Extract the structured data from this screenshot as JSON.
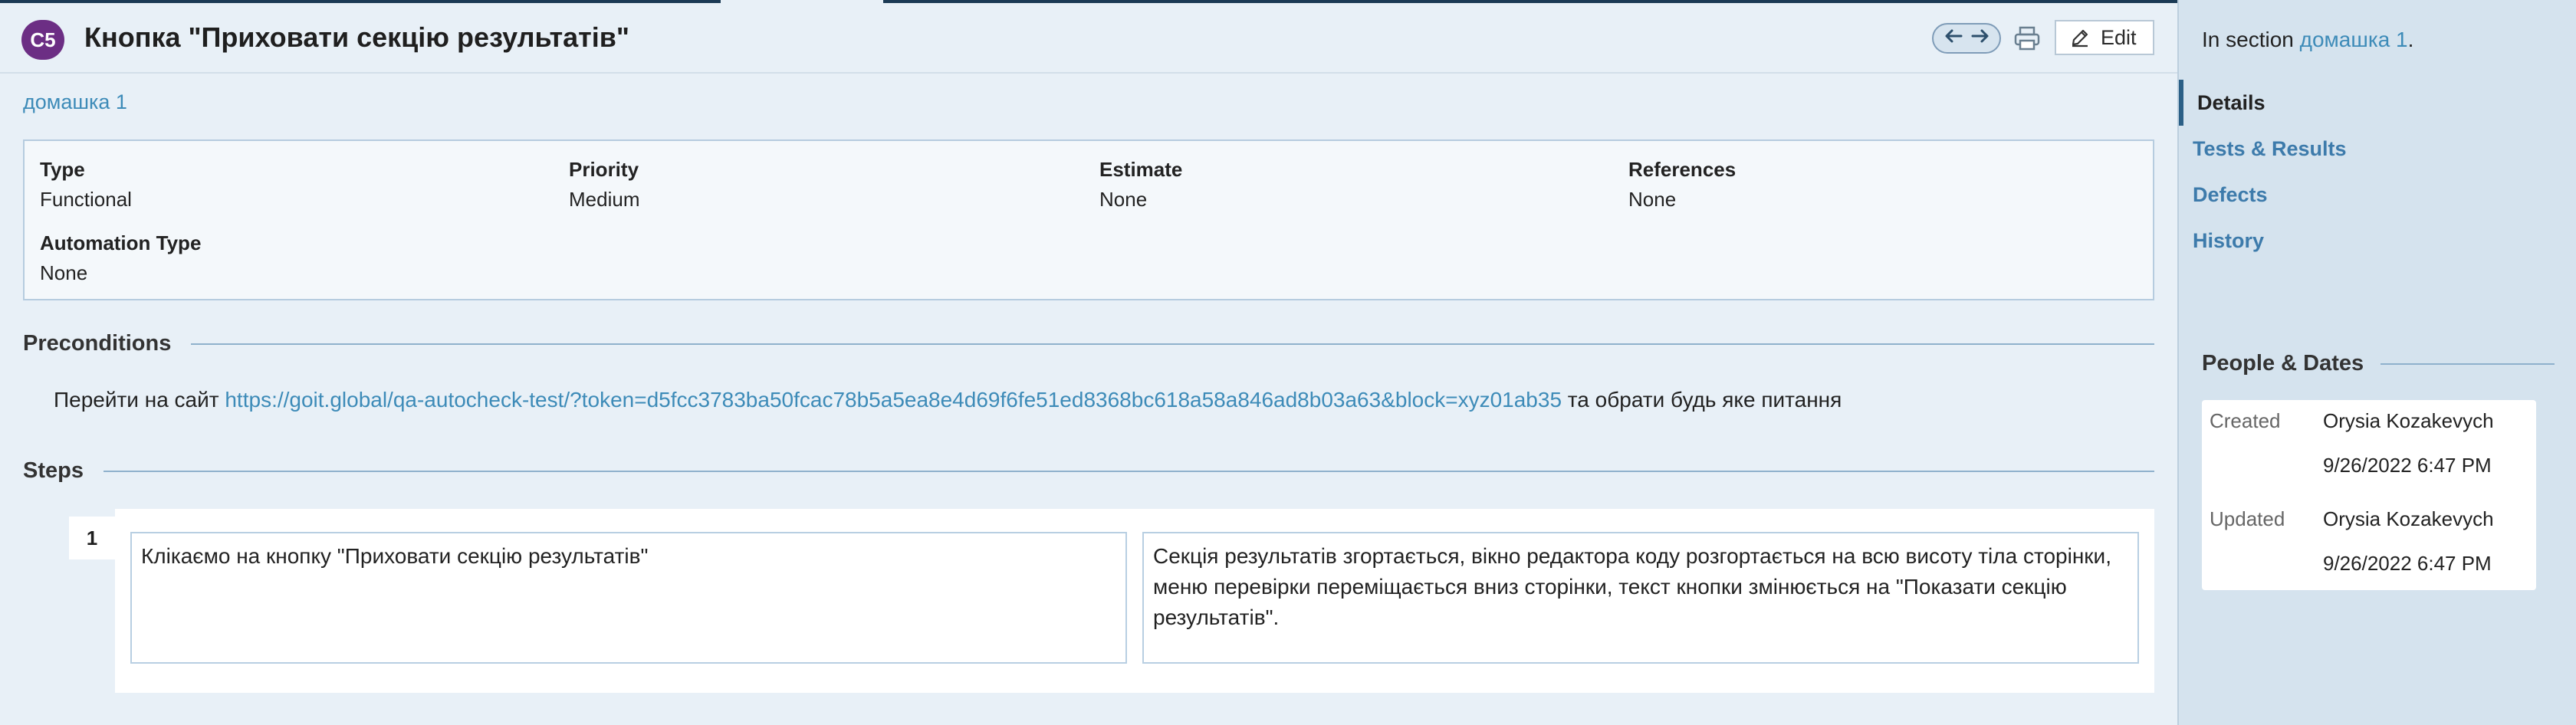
{
  "header": {
    "case_id": "C5",
    "title": "Кнопка \"Приховати секцію результатів\"",
    "nav_prev_icon": "arrow-left-icon",
    "nav_next_icon": "arrow-right-icon",
    "print_icon": "printer-icon",
    "edit_label": "Edit"
  },
  "section_link": "домашка 1",
  "details": {
    "type_label": "Type",
    "type_value": "Functional",
    "priority_label": "Priority",
    "priority_value": "Medium",
    "estimate_label": "Estimate",
    "estimate_value": "None",
    "references_label": "References",
    "references_value": "None",
    "automation_label": "Automation Type",
    "automation_value": "None"
  },
  "preconditions": {
    "heading": "Preconditions",
    "text_before": "Перейти на сайт ",
    "link": "https://goit.global/qa-autocheck-test/?token=d5fcc3783ba50fcac78b5a5ea8e4d69f6fe51ed8368bc618a58a846ad8b03a63&block=xyz01ab35",
    "text_after": " та обрати будь яке питання"
  },
  "steps": {
    "heading": "Steps",
    "items": [
      {
        "number": "1",
        "action": "Клікаємо на кнопку \"Приховати секцію результатів\"",
        "expected": "Секція результатів згортається, вікно редактора коду розгортається на всю висоту тіла сторінки, меню перевірки переміщається вниз сторінки, текст кнопки змінюється на \"Показати секцію результатів\"."
      }
    ]
  },
  "sidebar": {
    "in_section_prefix": "In section ",
    "in_section_link": "домашка 1",
    "in_section_suffix": ".",
    "nav": [
      {
        "label": "Details",
        "active": true
      },
      {
        "label": "Tests & Results",
        "active": false
      },
      {
        "label": "Defects",
        "active": false
      },
      {
        "label": "History",
        "active": false
      }
    ],
    "people_heading": "People & Dates",
    "created_label": "Created",
    "created_by": "Orysia Kozakevych",
    "created_at": "9/26/2022 6:47 PM",
    "updated_label": "Updated",
    "updated_by": "Orysia Kozakevych",
    "updated_at": "9/26/2022 6:47 PM"
  },
  "colors": {
    "badge": "#6c2e84",
    "link": "#3d8bb8",
    "sidebar_bg": "#d5e3ee",
    "main_bg": "#e8f0f7"
  }
}
